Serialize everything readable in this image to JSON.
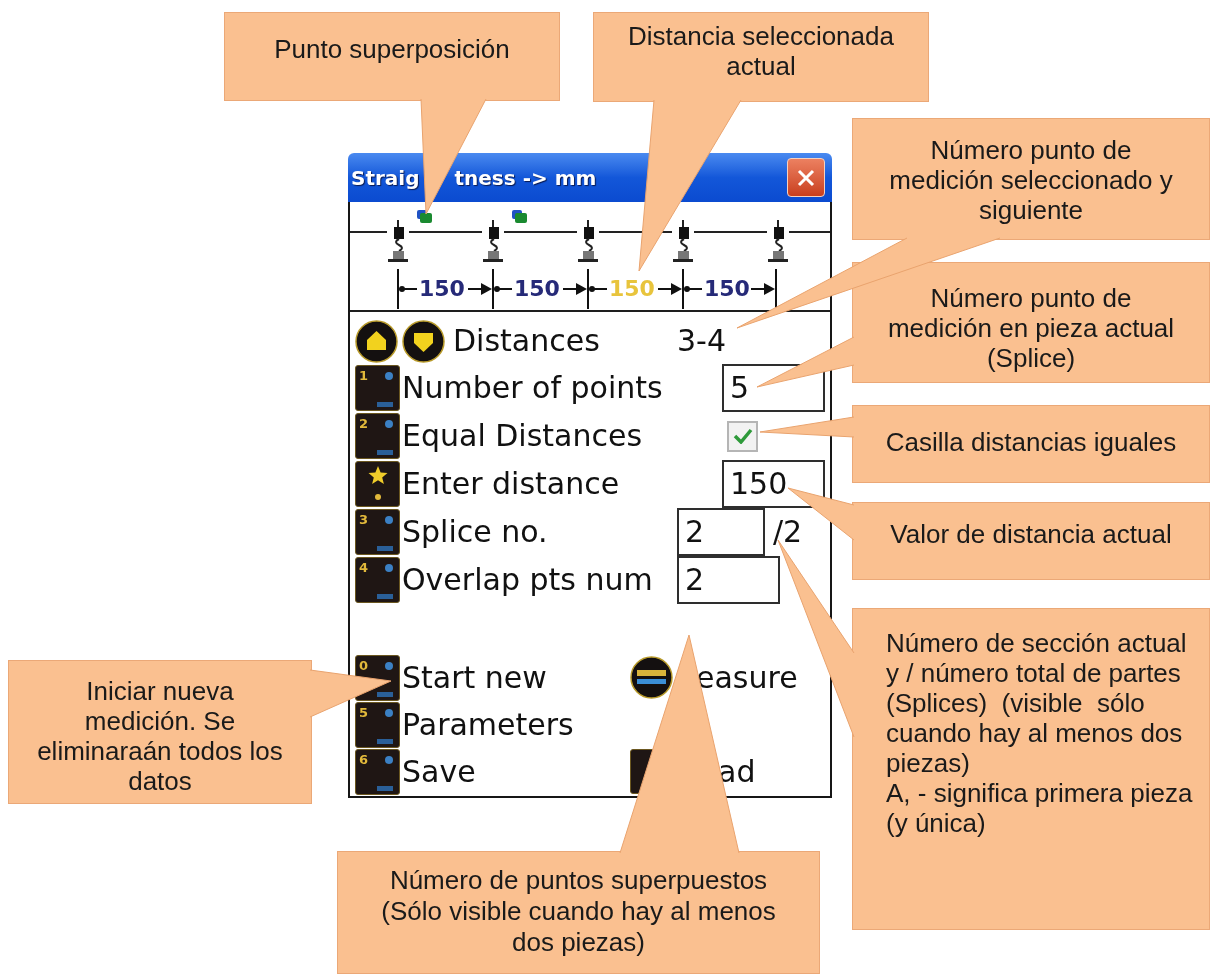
{
  "window": {
    "title_parts": [
      "Straig",
      "tness -> mm"
    ]
  },
  "ruler": {
    "sensors": [
      {
        "overlap": true
      },
      {
        "overlap": true
      },
      {
        "overlap": false
      },
      {
        "overlap": false
      },
      {
        "overlap": false
      }
    ],
    "segments": [
      {
        "label": "150",
        "selected": false
      },
      {
        "label": "150",
        "selected": false
      },
      {
        "label": "150",
        "selected": true
      },
      {
        "label": "150",
        "selected": false
      }
    ]
  },
  "distances": {
    "label": "Distances",
    "value": "3-4"
  },
  "settings": [
    {
      "kind": "field",
      "key": {
        "kind": "digit",
        "label": "1"
      },
      "label": "Number of points",
      "value": "5"
    },
    {
      "kind": "checkbox",
      "key": {
        "kind": "digit",
        "label": "2"
      },
      "label": "Equal Distances",
      "checked": true
    },
    {
      "kind": "field",
      "key": {
        "kind": "star"
      },
      "label": "Enter distance",
      "value": "150"
    },
    {
      "kind": "field",
      "key": {
        "kind": "digit",
        "label": "3"
      },
      "label": "Splice no.",
      "value": "2",
      "total": "/2"
    },
    {
      "kind": "field",
      "key": {
        "kind": "digit",
        "label": "4"
      },
      "label": "Overlap pts num",
      "value": "2"
    }
  ],
  "actions": [
    {
      "key": {
        "kind": "digit",
        "label": "0"
      },
      "label": "Start new",
      "side": {
        "kind": "round",
        "text": "easure"
      }
    },
    {
      "key": {
        "kind": "digit",
        "label": "5"
      },
      "label": "Parameters"
    },
    {
      "key": {
        "kind": "digit",
        "label": "6"
      },
      "label": "Save",
      "side": {
        "kind": "square",
        "text": "ad"
      }
    }
  ],
  "callouts": [
    "Punto superposición",
    "Distancia seleccionada\nactual",
    "Número punto de\nmedición seleccionado y\nsiguiente",
    "Número punto de\nmedición en pieza actual\n(Splice)",
    "Casilla distancias iguales",
    "Valor de distancia actual",
    "Iniciar nueva\nmedición. Se\neliminaraán todos los\ndatos",
    "Número de sección actual\ny / número total de partes\n(Splices)  (visible  sólo\ncuando hay al menos dos\npiezas)\nA, - significa primera pieza\n(y única)",
    "Número de puntos superpuestos\n(Sólo visible cuando hay al menos\ndos piezas)"
  ]
}
